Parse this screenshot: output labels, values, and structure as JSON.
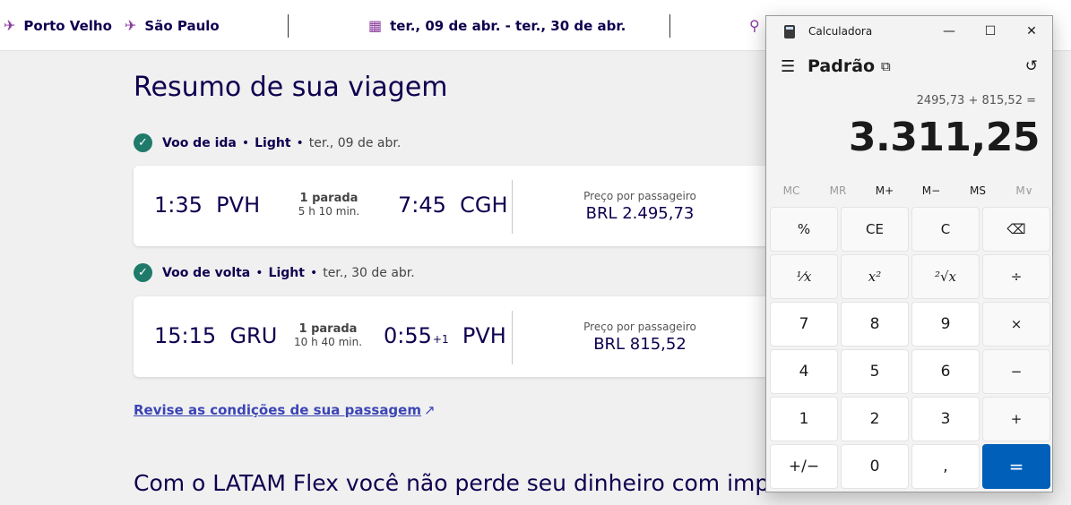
{
  "topbar": {
    "origin": "Porto Velho",
    "destination": "São Paulo",
    "dates": "ter., 09 de abr. - ter., 30 de abr."
  },
  "summary": {
    "title": "Resumo de sua viagem",
    "outbound": {
      "label": "Voo de ida",
      "fare": "Light",
      "date": "ter., 09 de abr.",
      "dep_time": "1:35",
      "dep_airport": "PVH",
      "stops": "1 parada",
      "duration": "5 h 10 min.",
      "arr_time": "7:45",
      "arr_airport": "CGH",
      "price_label": "Preço por passageiro",
      "price": "BRL 2.495,73"
    },
    "return": {
      "label": "Voo de volta",
      "fare": "Light",
      "date": "ter., 30 de abr.",
      "dep_time": "15:15",
      "dep_airport": "GRU",
      "stops": "1 parada",
      "duration": "10 h 40 min.",
      "arr_time": "0:55",
      "arr_day_offset": "+1",
      "arr_airport": "PVH",
      "price_label": "Preço por passageiro",
      "price": "BRL 815,52"
    },
    "conditions_link": "Revise as condições de sua passagem",
    "flex_heading": "Com o LATAM Flex você não perde seu dinheiro com imprevis"
  },
  "calculator": {
    "window_title": "Calculadora",
    "mode": "Padrão",
    "expression": "2495,73 + 815,52 =",
    "display": "3.311,25",
    "memory": [
      "MC",
      "MR",
      "M+",
      "M−",
      "MS",
      "M∨"
    ],
    "keys": {
      "percent": "%",
      "ce": "CE",
      "c": "C",
      "backspace": "⌫",
      "reciprocal": "⅟x",
      "square": "x²",
      "sqrt": "²√x",
      "divide": "÷",
      "seven": "7",
      "eight": "8",
      "nine": "9",
      "multiply": "×",
      "four": "4",
      "five": "5",
      "six": "6",
      "minus": "−",
      "one": "1",
      "two": "2",
      "three": "3",
      "plus": "+",
      "negate": "+/−",
      "zero": "0",
      "decimal": ",",
      "equals": "="
    }
  },
  "colors": {
    "brand_text": "#10004f",
    "link": "#3b45b5",
    "check": "#1f7a6a",
    "calc_accent": "#005fb8"
  }
}
